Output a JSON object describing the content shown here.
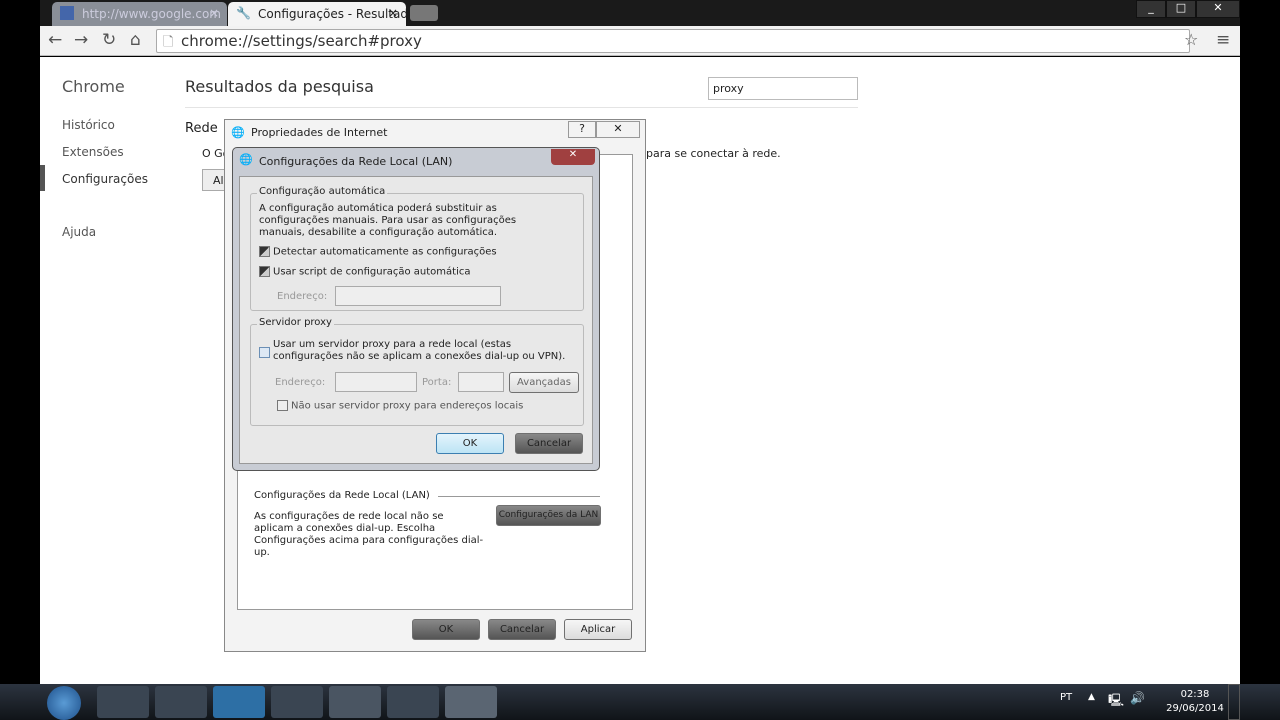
{
  "browser": {
    "tabs": [
      {
        "label": "http://www.google.com",
        "icon": "google-icon"
      },
      {
        "label": "Configurações - Resultado",
        "icon": "wrench-icon"
      }
    ],
    "url": "chrome://settings/search#proxy",
    "win_buttons": [
      "_",
      "□",
      "✕"
    ]
  },
  "settings": {
    "brand": "Chrome",
    "sidebar": [
      {
        "label": "Histórico"
      },
      {
        "label": "Extensões"
      },
      {
        "label": "Configurações",
        "selected": true
      },
      {
        "label": "Ajuda"
      }
    ],
    "title": "Resultados da pesquisa",
    "search_value": "proxy",
    "section": "Rede",
    "partial_text_left": "O Go",
    "partial_text_right": "para se conectar à rede.",
    "partial_button": "Al"
  },
  "inet_dialog": {
    "title": "Propriedades de Internet",
    "help": "?",
    "close": "✕",
    "lan_group": "Configurações da Rede Local (LAN)",
    "lan_text": "As configurações de rede local não se aplicam a conexões dial-up. Escolha Configurações acima para configurações dial-up.",
    "lan_button": "Configurações da LAN",
    "ok": "OK",
    "cancel": "Cancelar",
    "apply": "Aplicar"
  },
  "lan_dialog": {
    "title": "Configurações da Rede Local (LAN)",
    "close": "✕",
    "auto_group": "Configuração automática",
    "auto_text": "A configuração automática poderá substituir as configurações manuais. Para usar as configurações manuais, desabilite a configuração automática.",
    "detect_label": "Detectar automaticamente as configurações",
    "detect_checked": true,
    "script_label": "Usar script de configuração automática",
    "script_checked": true,
    "address_label": "Endereço:",
    "proxy_group": "Servidor proxy",
    "proxy_label": "Usar um servidor proxy para a rede local (estas configurações não se aplicam a conexões dial-up ou VPN).",
    "proxy_checked": false,
    "proxy_address_label": "Endereço:",
    "port_label": "Porta:",
    "advanced": "Avançadas",
    "bypass_label": "Não usar servidor proxy para endereços locais",
    "bypass_checked": false,
    "ok": "OK",
    "cancel": "Cancelar"
  },
  "taskbar": {
    "lang": "PT",
    "time": "02:38",
    "date": "29/06/2014",
    "apps": [
      "start",
      "explorer",
      "media",
      "skype",
      "firefox",
      "chrome",
      "game",
      "internet-options"
    ]
  }
}
